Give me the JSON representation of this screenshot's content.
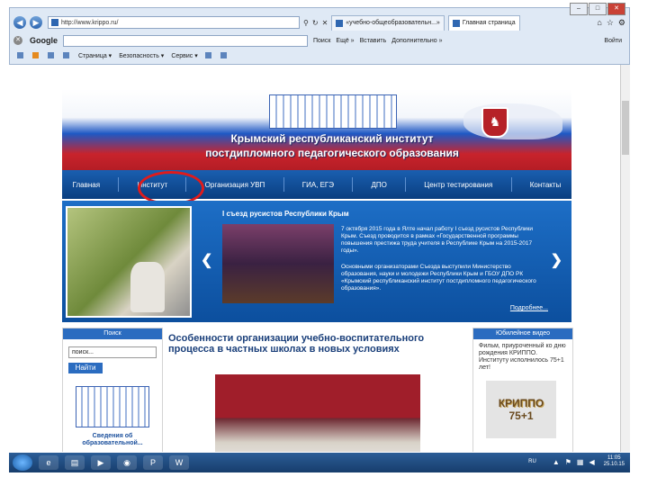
{
  "browser": {
    "address": "http://www.krippo.ru/",
    "tabs": [
      {
        "label": "«учебно-общеобразовательн...»"
      },
      {
        "label": "Главная страница"
      }
    ],
    "google_logo": "Google",
    "google_actions": [
      "Поиск",
      "Ещё »",
      "Войти"
    ],
    "google_extra": "Вставить",
    "google_extra2": "Дополнительно »",
    "commands": [
      "Страница ▾",
      "Безопасность ▾",
      "Сервис ▾"
    ],
    "window_controls": [
      "–",
      "□",
      "✕"
    ]
  },
  "site": {
    "banner_title1": "Крымский республиканский институт",
    "banner_title2": "постдипломного педагогического образования",
    "nav": [
      {
        "label": "Главная"
      },
      {
        "label": "Институт"
      },
      {
        "label": "Организация УВП"
      },
      {
        "label": "ГИА, ЕГЭ"
      },
      {
        "label": "ДПО"
      },
      {
        "label": "Центр тестирования"
      },
      {
        "label": "Контакты"
      }
    ],
    "slide": {
      "heading": "I съезд русистов Республики Крым",
      "p1": "7 октября 2015 года в Ялте начал работу I съезд русистов Республики Крым. Съезд проводится в рамках «Государственной программы повышения престижа труда учителя в Республике Крым на 2015-2017 годы».",
      "p2": "Основными организаторами Съезда выступили Министерство образования, науки и молодежи Республики Крым и ГБОУ ДПО РК «Крымский республиканский институт постдипломного педагогического образования».",
      "more": "Подробнее...",
      "prev": "❮",
      "next": "❯"
    },
    "search": {
      "title": "Поиск",
      "placeholder": "поиск...",
      "button": "Найти"
    },
    "left_caption": "Сведения об образовательной...",
    "article_title": "Особенности организации учебно-воспитательного процесса в частных школах в новых условиях",
    "video": {
      "title": "Юбилейное видео",
      "text": "Фильм, приуроченный ко дню рождения КРИППО. Институту исполнилось 75+1 лет!",
      "logo": "КРИППО",
      "num": "75+1"
    }
  },
  "taskbar": {
    "lang": "RU",
    "time": "11:05",
    "date": "25.10.15"
  },
  "colors": {
    "nav_blue": "#0a3f80",
    "accent_red": "#e01b1b"
  }
}
